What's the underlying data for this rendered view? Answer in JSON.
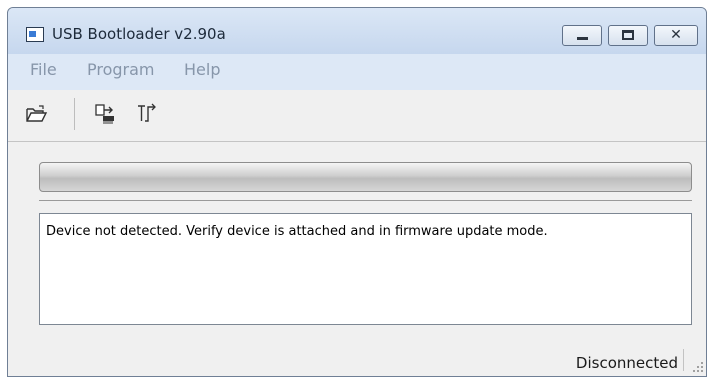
{
  "window": {
    "title": "USB Bootloader v2.90a",
    "controls": {
      "minimize": "minimize",
      "maximize": "maximize",
      "close": "close",
      "close_glyph": "✕"
    }
  },
  "menu": [
    {
      "label": "File"
    },
    {
      "label": "Program"
    },
    {
      "label": "Help"
    }
  ],
  "toolbar": {
    "buttons": [
      {
        "icon": "open-folder-icon"
      },
      {
        "icon": "program-device-icon"
      },
      {
        "icon": "reset-device-icon"
      }
    ]
  },
  "progress": {
    "value": 0
  },
  "log": {
    "text": "Device not detected.  Verify device is attached and in firmware update mode."
  },
  "status": {
    "connection": "Disconnected"
  },
  "colors": {
    "title_bar": "#c9d9ee",
    "menu_text_disabled": "#8796aa",
    "client_bg": "#f0f0f0"
  }
}
